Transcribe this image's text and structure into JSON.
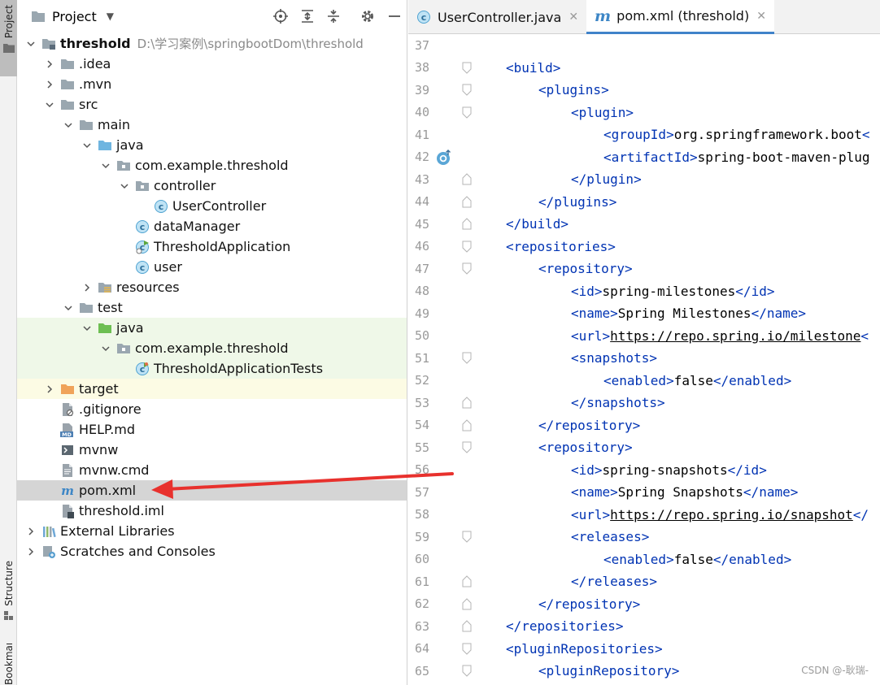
{
  "tool_strip": {
    "project_tab": "Project",
    "structure_tab": "Structure",
    "bookmarks_tab": "Bookmarks"
  },
  "project_panel": {
    "title": "Project",
    "tree": [
      {
        "label": "threshold",
        "path": "D:\\学习案例\\springbootDom\\threshold",
        "depth": 0,
        "arrow": "down",
        "icon": "module-folder-icon",
        "bold": true,
        "bg": ""
      },
      {
        "label": ".idea",
        "depth": 1,
        "arrow": "right",
        "icon": "folder-icon",
        "bg": ""
      },
      {
        "label": ".mvn",
        "depth": 1,
        "arrow": "right",
        "icon": "folder-icon",
        "bg": ""
      },
      {
        "label": "src",
        "depth": 1,
        "arrow": "down",
        "icon": "folder-icon",
        "bg": ""
      },
      {
        "label": "main",
        "depth": 2,
        "arrow": "down",
        "icon": "folder-icon",
        "bg": ""
      },
      {
        "label": "java",
        "depth": 3,
        "arrow": "down",
        "icon": "source-folder-icon",
        "bg": ""
      },
      {
        "label": "com.example.threshold",
        "depth": 4,
        "arrow": "down",
        "icon": "package-icon",
        "bg": ""
      },
      {
        "label": "controller",
        "depth": 5,
        "arrow": "down",
        "icon": "package-icon",
        "bg": ""
      },
      {
        "label": "UserController",
        "depth": 6,
        "arrow": "",
        "icon": "class-icon",
        "bg": ""
      },
      {
        "label": "dataManager",
        "depth": 5,
        "arrow": "",
        "icon": "class-icon",
        "bg": ""
      },
      {
        "label": "ThresholdApplication",
        "depth": 5,
        "arrow": "",
        "icon": "spring-app-class-icon",
        "bg": ""
      },
      {
        "label": "user",
        "depth": 5,
        "arrow": "",
        "icon": "class-icon",
        "bg": ""
      },
      {
        "label": "resources",
        "depth": 3,
        "arrow": "right",
        "icon": "resources-folder-icon",
        "bg": ""
      },
      {
        "label": "test",
        "depth": 2,
        "arrow": "down",
        "icon": "folder-icon",
        "bg": ""
      },
      {
        "label": "java",
        "depth": 3,
        "arrow": "down",
        "icon": "test-source-folder-icon",
        "bg": "test"
      },
      {
        "label": "com.example.threshold",
        "depth": 4,
        "arrow": "down",
        "icon": "package-icon",
        "bg": "test"
      },
      {
        "label": "ThresholdApplicationTests",
        "depth": 5,
        "arrow": "",
        "icon": "spring-test-class-icon",
        "bg": "test"
      },
      {
        "label": "target",
        "depth": 1,
        "arrow": "right",
        "icon": "excluded-folder-icon",
        "bg": "excluded"
      },
      {
        "label": ".gitignore",
        "depth": 1,
        "arrow": "",
        "icon": "ignore-file-icon",
        "bg": ""
      },
      {
        "label": "HELP.md",
        "depth": 1,
        "arrow": "",
        "icon": "markdown-file-icon",
        "bg": ""
      },
      {
        "label": "mvnw",
        "depth": 1,
        "arrow": "",
        "icon": "shell-file-icon",
        "bg": ""
      },
      {
        "label": "mvnw.cmd",
        "depth": 1,
        "arrow": "",
        "icon": "text-file-icon",
        "bg": ""
      },
      {
        "label": "pom.xml",
        "depth": 1,
        "arrow": "",
        "icon": "maven-file-icon",
        "bg": "selected"
      },
      {
        "label": "threshold.iml",
        "depth": 1,
        "arrow": "",
        "icon": "iml-file-icon",
        "bg": ""
      },
      {
        "label": "External Libraries",
        "depth": 0,
        "arrow": "right",
        "icon": "libraries-icon",
        "bg": ""
      },
      {
        "label": "Scratches and Consoles",
        "depth": 0,
        "arrow": "right",
        "icon": "scratches-icon",
        "bg": ""
      }
    ]
  },
  "editor": {
    "tabs": [
      {
        "label": "UserController.java",
        "icon": "class-icon",
        "active": false
      },
      {
        "label": "pom.xml (threshold)",
        "icon": "maven-file-icon",
        "active": true
      }
    ],
    "lines": [
      {
        "n": "37",
        "indent": 0,
        "parts": [],
        "fold": ""
      },
      {
        "n": "38",
        "indent": 1,
        "parts": [
          [
            "t",
            "<build>"
          ]
        ],
        "fold": "open"
      },
      {
        "n": "39",
        "indent": 2,
        "parts": [
          [
            "t",
            "<plugins>"
          ]
        ],
        "fold": "open"
      },
      {
        "n": "40",
        "indent": 3,
        "parts": [
          [
            "t",
            "<plugin>"
          ]
        ],
        "fold": "open"
      },
      {
        "n": "41",
        "indent": 4,
        "parts": [
          [
            "t",
            "<groupId>"
          ],
          [
            "p",
            "org.springframework.boot"
          ],
          [
            "t",
            "<"
          ]
        ],
        "fold": ""
      },
      {
        "n": "42",
        "indent": 4,
        "parts": [
          [
            "t",
            "<artifactId>"
          ],
          [
            "p",
            "spring-boot-maven-plug"
          ]
        ],
        "fold": "",
        "marker": "override-marker-icon"
      },
      {
        "n": "43",
        "indent": 3,
        "parts": [
          [
            "t",
            "</plugin>"
          ]
        ],
        "fold": "close"
      },
      {
        "n": "44",
        "indent": 2,
        "parts": [
          [
            "t",
            "</plugins>"
          ]
        ],
        "fold": "close"
      },
      {
        "n": "45",
        "indent": 1,
        "parts": [
          [
            "t",
            "</build>"
          ]
        ],
        "fold": "close"
      },
      {
        "n": "46",
        "indent": 1,
        "parts": [
          [
            "t",
            "<repositories>"
          ]
        ],
        "fold": "open"
      },
      {
        "n": "47",
        "indent": 2,
        "parts": [
          [
            "t",
            "<repository>"
          ]
        ],
        "fold": "open"
      },
      {
        "n": "48",
        "indent": 3,
        "parts": [
          [
            "t",
            "<id>"
          ],
          [
            "p",
            "spring-milestones"
          ],
          [
            "t",
            "</id>"
          ]
        ],
        "fold": ""
      },
      {
        "n": "49",
        "indent": 3,
        "parts": [
          [
            "t",
            "<name>"
          ],
          [
            "p",
            "Spring Milestones"
          ],
          [
            "t",
            "</name>"
          ]
        ],
        "fold": ""
      },
      {
        "n": "50",
        "indent": 3,
        "parts": [
          [
            "t",
            "<url>"
          ],
          [
            "u",
            "https://repo.spring.io/milestone"
          ],
          [
            "t",
            "<"
          ]
        ],
        "fold": ""
      },
      {
        "n": "51",
        "indent": 3,
        "parts": [
          [
            "t",
            "<snapshots>"
          ]
        ],
        "fold": "open"
      },
      {
        "n": "52",
        "indent": 4,
        "parts": [
          [
            "t",
            "<enabled>"
          ],
          [
            "p",
            "false"
          ],
          [
            "t",
            "</enabled>"
          ]
        ],
        "fold": ""
      },
      {
        "n": "53",
        "indent": 3,
        "parts": [
          [
            "t",
            "</snapshots>"
          ]
        ],
        "fold": "close"
      },
      {
        "n": "54",
        "indent": 2,
        "parts": [
          [
            "t",
            "</repository>"
          ]
        ],
        "fold": "close"
      },
      {
        "n": "55",
        "indent": 2,
        "parts": [
          [
            "t",
            "<repository>"
          ]
        ],
        "fold": "open"
      },
      {
        "n": "56",
        "indent": 3,
        "parts": [
          [
            "t",
            "<id>"
          ],
          [
            "p",
            "spring-snapshots"
          ],
          [
            "t",
            "</id>"
          ]
        ],
        "fold": ""
      },
      {
        "n": "57",
        "indent": 3,
        "parts": [
          [
            "t",
            "<name>"
          ],
          [
            "p",
            "Spring Snapshots"
          ],
          [
            "t",
            "</name>"
          ]
        ],
        "fold": ""
      },
      {
        "n": "58",
        "indent": 3,
        "parts": [
          [
            "t",
            "<url>"
          ],
          [
            "u",
            "https://repo.spring.io/snapshot"
          ],
          [
            "t",
            "</"
          ]
        ],
        "fold": ""
      },
      {
        "n": "59",
        "indent": 3,
        "parts": [
          [
            "t",
            "<releases>"
          ]
        ],
        "fold": "open"
      },
      {
        "n": "60",
        "indent": 4,
        "parts": [
          [
            "t",
            "<enabled>"
          ],
          [
            "p",
            "false"
          ],
          [
            "t",
            "</enabled>"
          ]
        ],
        "fold": ""
      },
      {
        "n": "61",
        "indent": 3,
        "parts": [
          [
            "t",
            "</releases>"
          ]
        ],
        "fold": "close"
      },
      {
        "n": "62",
        "indent": 2,
        "parts": [
          [
            "t",
            "</repository>"
          ]
        ],
        "fold": "close"
      },
      {
        "n": "63",
        "indent": 1,
        "parts": [
          [
            "t",
            "</repositories>"
          ]
        ],
        "fold": "close"
      },
      {
        "n": "64",
        "indent": 1,
        "parts": [
          [
            "t",
            "<pluginRepositories>"
          ]
        ],
        "fold": "open"
      },
      {
        "n": "65",
        "indent": 2,
        "parts": [
          [
            "t",
            "<pluginRepository>"
          ]
        ],
        "fold": "open"
      }
    ]
  },
  "colors": {
    "tag": "#0033b3",
    "selection": "#d5d5d5",
    "test_background": "#eff8e8",
    "excluded_background": "#fcfbe4",
    "annotation_arrow": "#e8312d",
    "active_tab_underline": "#4083c9"
  },
  "watermark": "CSDN @-耿瑞-"
}
